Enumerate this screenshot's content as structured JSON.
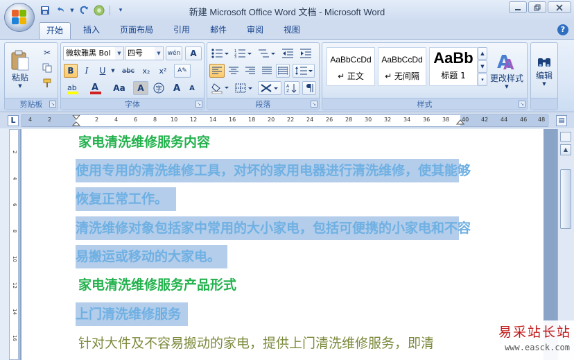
{
  "window": {
    "title": "新建 Microsoft Office Word 文档 - Microsoft Word",
    "minimize_icon": "minimize-icon",
    "maximize_icon": "restore-icon",
    "close_icon": "close-icon"
  },
  "quick_access": [
    "save-icon",
    "undo-icon",
    "redo-icon",
    "customize-icon"
  ],
  "tabs": [
    {
      "label": "开始",
      "active": true
    },
    {
      "label": "插入"
    },
    {
      "label": "页面布局"
    },
    {
      "label": "引用"
    },
    {
      "label": "邮件"
    },
    {
      "label": "审阅"
    },
    {
      "label": "视图"
    }
  ],
  "ribbon": {
    "clipboard": {
      "label": "剪贴板",
      "paste_label": "粘贴"
    },
    "font": {
      "label": "字体",
      "font_name": "微软雅黑 Bol",
      "font_size": "四号",
      "bold": "B",
      "italic": "I",
      "underline": "U",
      "strike": "abc",
      "subscript": "x₂",
      "superscript": "x²",
      "grow": "A",
      "shrink": "A",
      "change_case": "Aa"
    },
    "paragraph": {
      "label": "段落"
    },
    "styles": {
      "label": "样式",
      "items": [
        {
          "sample": "AaBbCcDd",
          "name": "↵ 正文"
        },
        {
          "sample": "AaBbCcDd",
          "name": "↵ 无间隔"
        },
        {
          "sample": "AaBb",
          "name": "标题 1"
        }
      ],
      "change_styles_label": "更改样式"
    },
    "editing": {
      "label": "编辑"
    }
  },
  "ruler": {
    "corner": "L",
    "ticks": [
      "4",
      "2",
      "",
      "2",
      "4",
      "6",
      "8",
      "10",
      "12",
      "14",
      "16",
      "18",
      "20",
      "22",
      "24",
      "26",
      "28",
      "30",
      "32",
      "34",
      "36",
      "38",
      "40",
      "42",
      "44",
      "46",
      "48"
    ],
    "vticks": [
      "2",
      "4",
      "6",
      "8",
      "10",
      "12",
      "14",
      "16"
    ]
  },
  "document": {
    "lines": [
      {
        "text": "家电清洗维修服务内容",
        "style": "green"
      },
      {
        "text": "使用专用的清洗维修工具，对坏的家用电器进行清洗维修，使其能够",
        "style": "hl"
      },
      {
        "text": "恢复正常工作。",
        "style": "hl"
      },
      {
        "text": "清洗维修对象包括家中常用的大小家电，包括可便携的小家电和不容",
        "style": "hl"
      },
      {
        "text": "易搬运或移动的大家电。",
        "style": "hl"
      },
      {
        "text": "家电清洗维修服务产品形式",
        "style": "green"
      },
      {
        "text": "上门清洗维修服务",
        "style": "hl"
      },
      {
        "text": "针对大件及不容易搬动的家电，提供上门清洗维修服务，即清",
        "style": "olive"
      }
    ]
  },
  "watermark": {
    "title": "易采站长站",
    "url": "www.easck.com"
  }
}
